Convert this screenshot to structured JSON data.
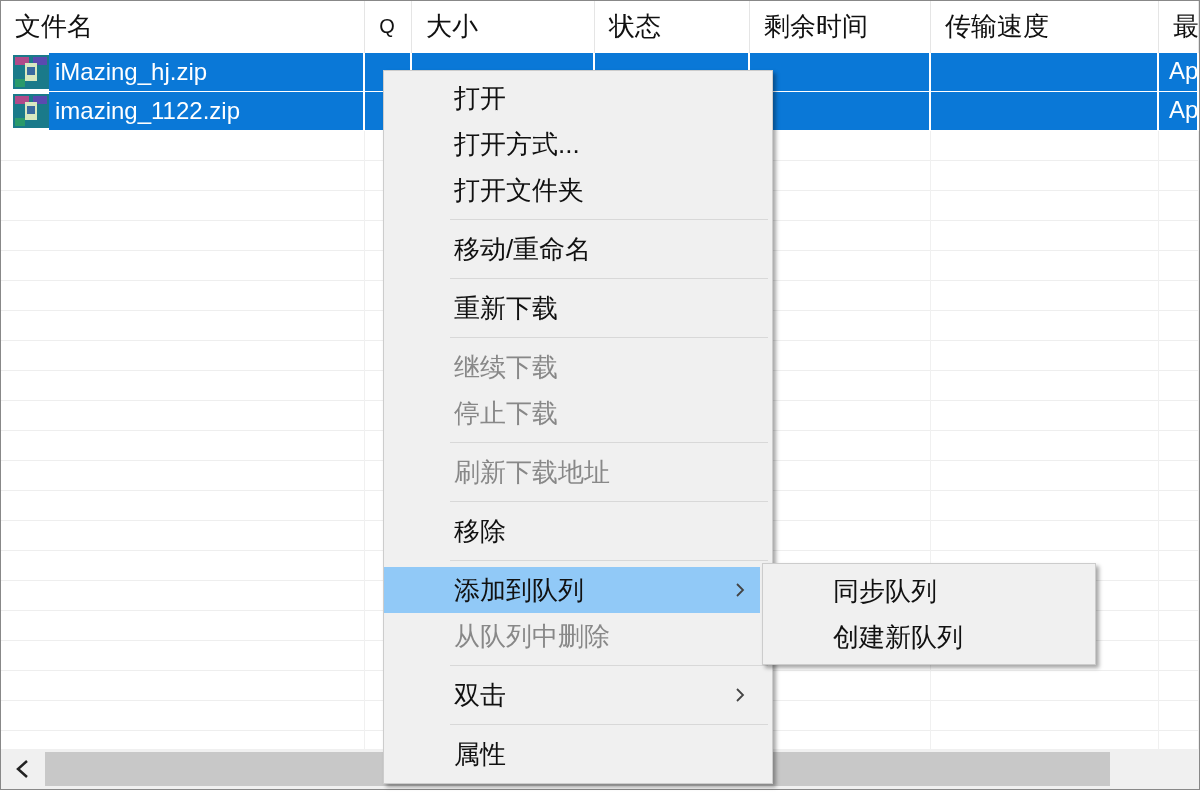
{
  "table": {
    "columns": [
      {
        "label": "文件名"
      },
      {
        "label": "Q"
      },
      {
        "label": "大小"
      },
      {
        "label": "状态"
      },
      {
        "label": "剩余时间"
      },
      {
        "label": "传输速度"
      },
      {
        "label": "最"
      }
    ],
    "rows": [
      {
        "selected": true,
        "name": "iMazing_hj.zip",
        "last": "Ap"
      },
      {
        "selected": true,
        "name": "imazing_1122.zip",
        "last": "Ap"
      }
    ]
  },
  "context_menu": {
    "items": [
      {
        "kind": "item",
        "label": "打开",
        "disabled": false,
        "selected": false,
        "submenu": false
      },
      {
        "kind": "item",
        "label": "打开方式...",
        "disabled": false,
        "selected": false,
        "submenu": false
      },
      {
        "kind": "item",
        "label": "打开文件夹",
        "disabled": false,
        "selected": false,
        "submenu": false
      },
      {
        "kind": "separator"
      },
      {
        "kind": "item",
        "label": "移动/重命名",
        "disabled": false,
        "selected": false,
        "submenu": false
      },
      {
        "kind": "separator"
      },
      {
        "kind": "item",
        "label": "重新下载",
        "disabled": false,
        "selected": false,
        "submenu": false
      },
      {
        "kind": "separator"
      },
      {
        "kind": "item",
        "label": "继续下载",
        "disabled": true,
        "selected": false,
        "submenu": false
      },
      {
        "kind": "item",
        "label": "停止下载",
        "disabled": true,
        "selected": false,
        "submenu": false
      },
      {
        "kind": "separator"
      },
      {
        "kind": "item",
        "label": "刷新下载地址",
        "disabled": true,
        "selected": false,
        "submenu": false
      },
      {
        "kind": "separator"
      },
      {
        "kind": "item",
        "label": "移除",
        "disabled": false,
        "selected": false,
        "submenu": false
      },
      {
        "kind": "separator"
      },
      {
        "kind": "item",
        "label": "添加到队列",
        "disabled": false,
        "selected": true,
        "submenu": true
      },
      {
        "kind": "item",
        "label": "从队列中删除",
        "disabled": true,
        "selected": false,
        "submenu": false
      },
      {
        "kind": "separator"
      },
      {
        "kind": "item",
        "label": "双击",
        "disabled": false,
        "selected": false,
        "submenu": true
      },
      {
        "kind": "separator"
      },
      {
        "kind": "item",
        "label": "属性",
        "disabled": false,
        "selected": false,
        "submenu": false
      }
    ]
  },
  "submenu": {
    "items": [
      {
        "label": "同步队列"
      },
      {
        "label": "创建新队列"
      }
    ]
  }
}
